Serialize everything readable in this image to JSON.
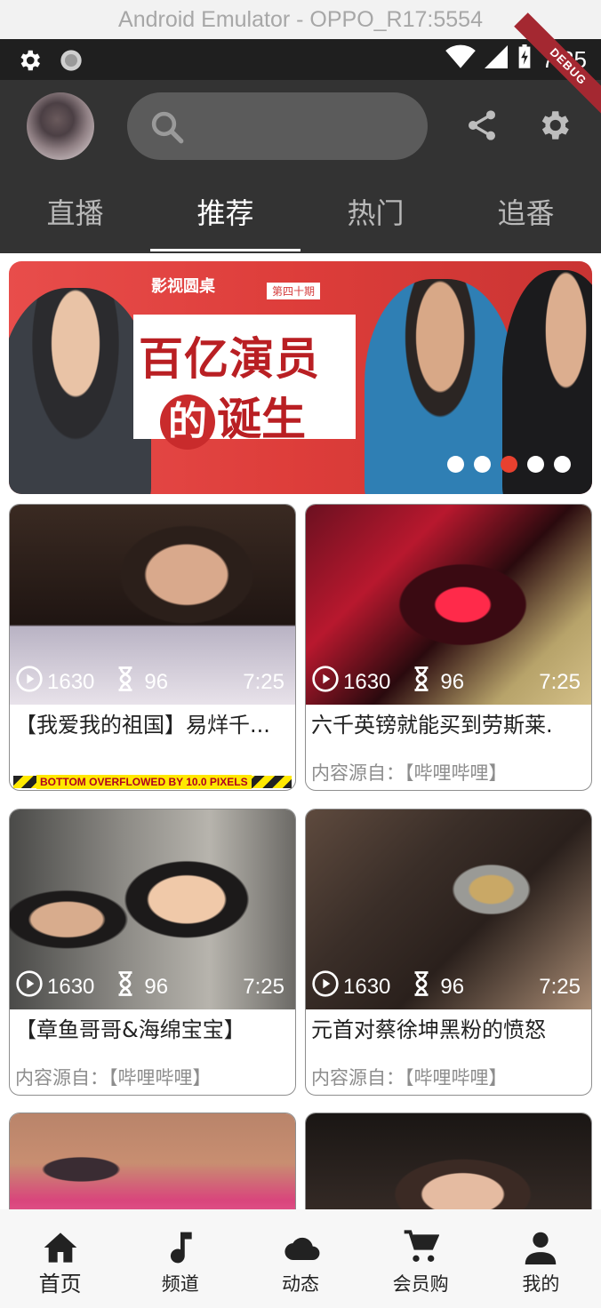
{
  "emulator": {
    "title": "Android Emulator - OPPO_R17:5554"
  },
  "status_bar": {
    "time": "7:35",
    "debug_label": "DEBUG"
  },
  "search": {
    "placeholder": ""
  },
  "tabs": [
    {
      "label": "直播",
      "active": false
    },
    {
      "label": "推荐",
      "active": true
    },
    {
      "label": "热门",
      "active": false
    },
    {
      "label": "追番",
      "active": false
    }
  ],
  "banner": {
    "brand": "影视圆桌",
    "issue": "第四十期",
    "line1": "百亿演员",
    "line2_circle": "的",
    "line2_rest": "诞生",
    "dots": 5,
    "active_dot": 2
  },
  "cards": [
    {
      "plays": "1630",
      "danmaku": "96",
      "duration": "7:25",
      "title": "【我爱我的祖国】易烊千...",
      "source": "",
      "overflow_label": "BOTTOM OVERFLOWED BY 10.0 PIXELS"
    },
    {
      "plays": "1630",
      "danmaku": "96",
      "duration": "7:25",
      "title": "六千英镑就能买到劳斯莱.",
      "source": "内容源自：【哔哩哔哩】",
      "overflow_label": ""
    },
    {
      "plays": "1630",
      "danmaku": "96",
      "duration": "7:25",
      "title": "【章鱼哥哥&海绵宝宝】",
      "source": "内容源自：【哔哩哔哩】",
      "overflow_label": ""
    },
    {
      "plays": "1630",
      "danmaku": "96",
      "duration": "7:25",
      "title": "元首对蔡徐坤黑粉的愤怒",
      "source": "内容源自：【哔哩哔哩】",
      "overflow_label": ""
    }
  ],
  "bottom_nav": [
    {
      "label": "首页",
      "icon": "home-icon",
      "active": true
    },
    {
      "label": "频道",
      "icon": "music-note-icon",
      "active": false
    },
    {
      "label": "动态",
      "icon": "cloud-icon",
      "active": false
    },
    {
      "label": "会员购",
      "icon": "cart-icon",
      "active": false
    },
    {
      "label": "我的",
      "icon": "person-icon",
      "active": false
    }
  ],
  "colors": {
    "appbar": "#333333",
    "accent_dot": "#e8412f",
    "banner": "#dd3d3a"
  }
}
